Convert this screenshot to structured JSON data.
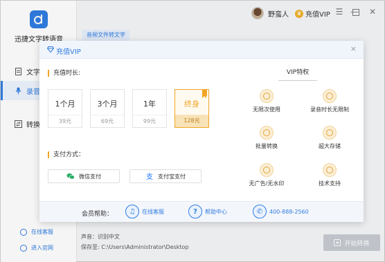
{
  "window": {
    "user_name": "野蛮人",
    "vip_label": "充值VIP"
  },
  "sidebar": {
    "app_name": "迅捷文字转语音",
    "items": [
      {
        "label": "文字",
        "icon": "document-icon"
      },
      {
        "label": "录音",
        "icon": "microphone-icon"
      },
      {
        "label": "转换",
        "icon": "convert-icon"
      }
    ],
    "bottom": [
      {
        "label": "在线客服",
        "icon": "headset-icon"
      },
      {
        "label": "进入官网",
        "icon": "globe-icon"
      }
    ]
  },
  "main": {
    "tab_label": "音频文件转文字",
    "voice_info": "声音：识别中文",
    "save_info": "保存至: C:\\Users\\Administrator\\Desktop",
    "start_label": "开始转换"
  },
  "modal": {
    "title": "充值VIP",
    "duration_label": "充值时长:",
    "plans": [
      {
        "name": "1个月",
        "price": "39元",
        "selected": false
      },
      {
        "name": "3个月",
        "price": "69元",
        "selected": false
      },
      {
        "name": "1年",
        "price": "99元",
        "selected": false
      },
      {
        "name": "终身",
        "price": "128元",
        "selected": true
      }
    ],
    "payment_label": "支付方式：",
    "payments": [
      {
        "label": "微信支付",
        "icon": "wechat-icon"
      },
      {
        "label": "支付宝支付",
        "icon": "alipay-icon"
      }
    ],
    "vip_features_title": "VIP特权",
    "features": [
      "无限次使用",
      "录音时长无限制",
      "批量转换",
      "超大存储",
      "无广告/无水印",
      "技术支持"
    ],
    "help_label": "会员帮助：",
    "help_items": [
      {
        "label": "在线客服",
        "icon": "headset-icon"
      },
      {
        "label": "帮助中心",
        "icon": "question-icon"
      },
      {
        "label": "400-888-2560",
        "icon": "phone-icon"
      }
    ]
  },
  "colors": {
    "accent": "#2f7de1",
    "gold": "#f1a524"
  }
}
